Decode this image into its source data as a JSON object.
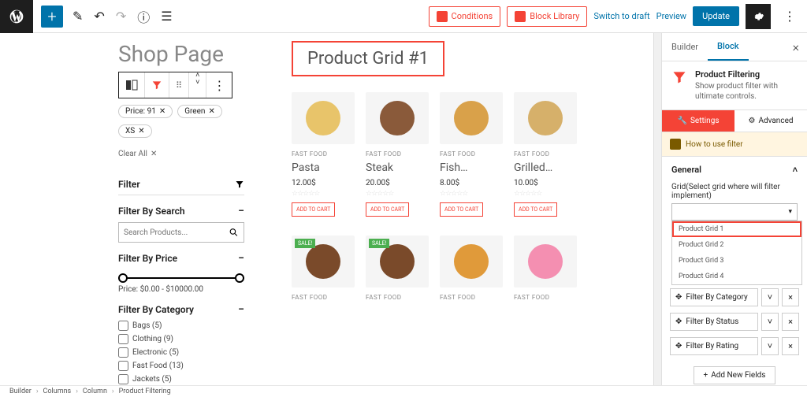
{
  "top": {
    "conditions": "Conditions",
    "block_library": "Block Library",
    "switch": "Switch to draft",
    "preview": "Preview",
    "update": "Update"
  },
  "page_title": "Shop Page",
  "pills": [
    "Price: 91",
    "Green",
    "XS"
  ],
  "clear_all": "Clear All",
  "filter_heading": "Filter",
  "filter_search_label": "Filter By Search",
  "search_placeholder": "Search Products...",
  "filter_price_label": "Filter By Price",
  "price_text": "Price: $0.00 - $10000.00",
  "filter_category_label": "Filter By Category",
  "categories": [
    "Bags (5)",
    "Clothing (9)",
    "Electronic (5)",
    "Fast Food (13)",
    "Jackets (5)"
  ],
  "grid_heading": "Product Grid #1",
  "products_row1": [
    {
      "cat": "FAST FOOD",
      "name": "Pasta",
      "price": "12.00$",
      "color": "#e8c46a"
    },
    {
      "cat": "FAST FOOD",
      "name": "Steak",
      "price": "20.00$",
      "color": "#8a5a3a"
    },
    {
      "cat": "FAST FOOD",
      "name": "Fish…",
      "price": "8.00$",
      "color": "#d9a14a"
    },
    {
      "cat": "FAST FOOD",
      "name": "Grilled…",
      "price": "10.00$",
      "color": "#d6b06a"
    }
  ],
  "products_row2": [
    {
      "cat": "FAST FOOD",
      "sale": true,
      "color": "#7a4a2a"
    },
    {
      "cat": "FAST FOOD",
      "sale": true,
      "color": "#7a4a2a"
    },
    {
      "cat": "FAST FOOD",
      "color": "#e09a3a"
    },
    {
      "cat": "FAST FOOD",
      "color": "#f48fb1"
    }
  ],
  "sale_label": "SALE!",
  "add_to_cart": "ADD TO CART",
  "sidebar": {
    "tab_builder": "Builder",
    "tab_block": "Block",
    "block_name": "Product Filtering",
    "block_desc": "Show product filter with ultimate controls.",
    "settings": "Settings",
    "advanced": "Advanced",
    "howto": "How to use filter",
    "general": "General",
    "grid_label": "Grid(Select grid where will filter implement)",
    "grid_options": [
      "Product Grid 1",
      "Product Grid 2",
      "Product Grid 3",
      "Product Grid 4"
    ],
    "fields": [
      "Filter By Category",
      "Filter By Status",
      "Filter By Rating"
    ],
    "add_fields": "Add New Fields"
  },
  "breadcrumb": [
    "Builder",
    "Columns",
    "Column",
    "Product Filtering"
  ]
}
